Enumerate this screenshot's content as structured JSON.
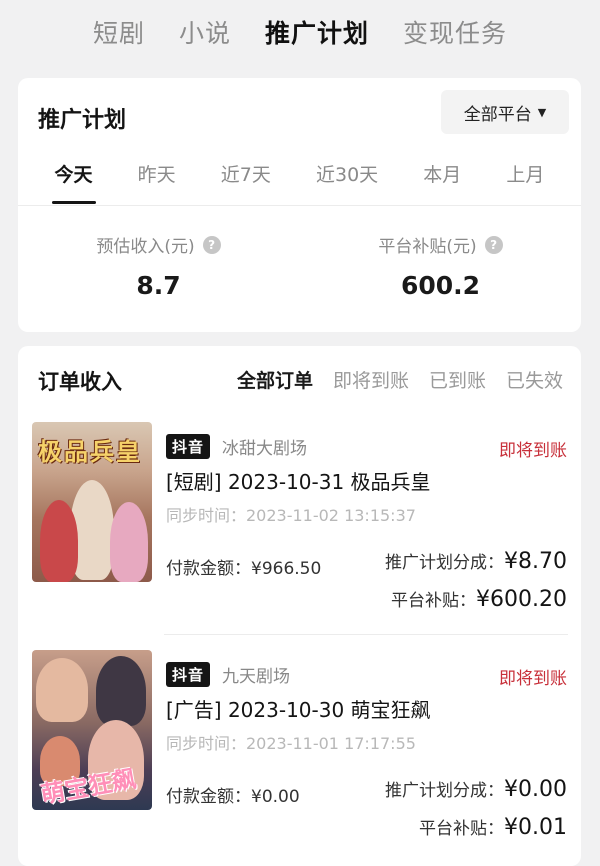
{
  "top_tabs": [
    "短剧",
    "小说",
    "推广计划",
    "变现任务"
  ],
  "promo": {
    "title": "推广计划",
    "platform_selector": "全部平台",
    "ranges": [
      "今天",
      "昨天",
      "近7天",
      "近30天",
      "本月",
      "上月"
    ],
    "stats": {
      "estimated_income_label": "预估收入(元)",
      "estimated_income_value": "8.7",
      "platform_subsidy_label": "平台补贴(元)",
      "platform_subsidy_value": "600.2"
    }
  },
  "orders": {
    "title": "订单收入",
    "filters": [
      "全部订单",
      "即将到账",
      "已到账",
      "已失效"
    ],
    "items": [
      {
        "platform": "抖音",
        "theater": "冰甜大剧场",
        "status": "即将到账",
        "title": "[短剧] 2023-10-31 极品兵皇",
        "sync_time": "同步时间：2023-11-02 13:15:37",
        "pay_label": "付款金额：",
        "pay_value": "¥966.50",
        "commission_label": "推广计划分成：",
        "commission_value": "¥8.70",
        "subsidy_label": "平台补贴：",
        "subsidy_value": "¥600.20",
        "poster_text": "极品兵皇"
      },
      {
        "platform": "抖音",
        "theater": "九天剧场",
        "status": "即将到账",
        "title": "[广告] 2023-10-30 萌宝狂飙",
        "sync_time": "同步时间：2023-11-01 17:17:55",
        "pay_label": "付款金额：",
        "pay_value": "¥0.00",
        "commission_label": "推广计划分成：",
        "commission_value": "¥0.00",
        "subsidy_label": "平台补贴：",
        "subsidy_value": "¥0.01",
        "poster_text": "萌宝狂飙"
      }
    ]
  },
  "colors": {
    "accent_status": "#c8303a",
    "background": "#f1f1f2"
  }
}
